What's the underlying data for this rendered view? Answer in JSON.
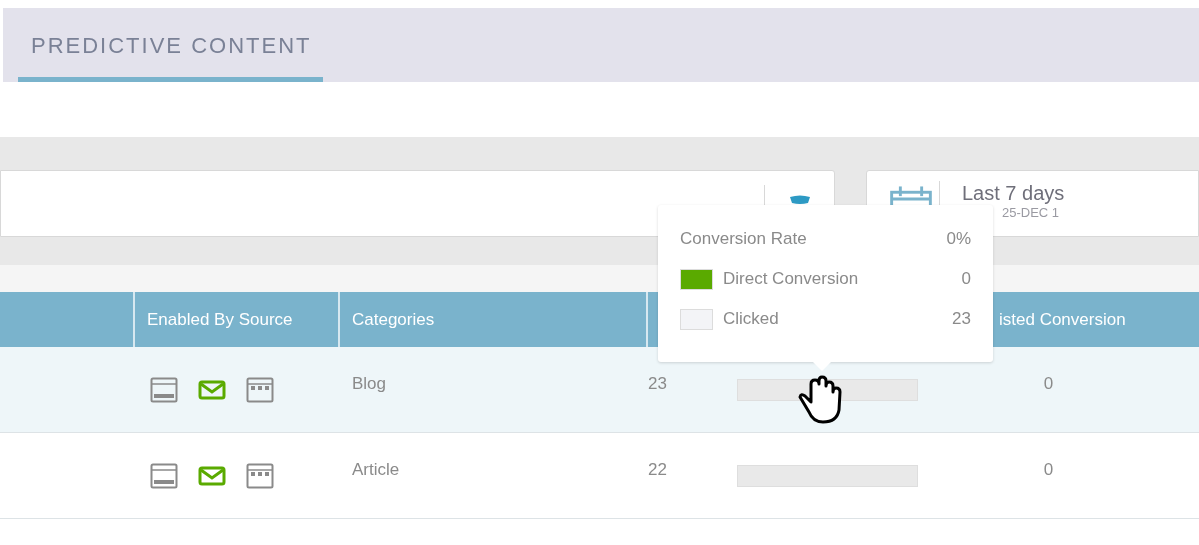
{
  "tab": {
    "label": "PREDICTIVE CONTENT",
    "selected": true
  },
  "date_range": {
    "label": "Last 7 days",
    "sub": "25-DEC 1"
  },
  "table": {
    "columns": [
      "Enabled By Source",
      "Categories",
      "isted Conversion"
    ],
    "rows": [
      {
        "highlighted": true,
        "category": "Blog",
        "count": "23",
        "assisted": "0",
        "sources": [
          {
            "kind": "page",
            "enabled": false
          },
          {
            "kind": "email",
            "enabled": true
          },
          {
            "kind": "calendar",
            "enabled": false
          }
        ]
      },
      {
        "highlighted": false,
        "category": "Article",
        "count": "22",
        "assisted": "0",
        "sources": [
          {
            "kind": "page",
            "enabled": false
          },
          {
            "kind": "email",
            "enabled": true
          },
          {
            "kind": "calendar",
            "enabled": false
          }
        ]
      }
    ]
  },
  "tooltip": {
    "rows": [
      {
        "kind": "plain",
        "label": "Conversion Rate",
        "value": "0%"
      },
      {
        "kind": "swatch",
        "label": "Direct Conversion",
        "value": "0",
        "color": "#5aaa00"
      },
      {
        "kind": "swatch",
        "label": "Clicked",
        "value": "23",
        "color": "#f3f4f7"
      }
    ]
  }
}
